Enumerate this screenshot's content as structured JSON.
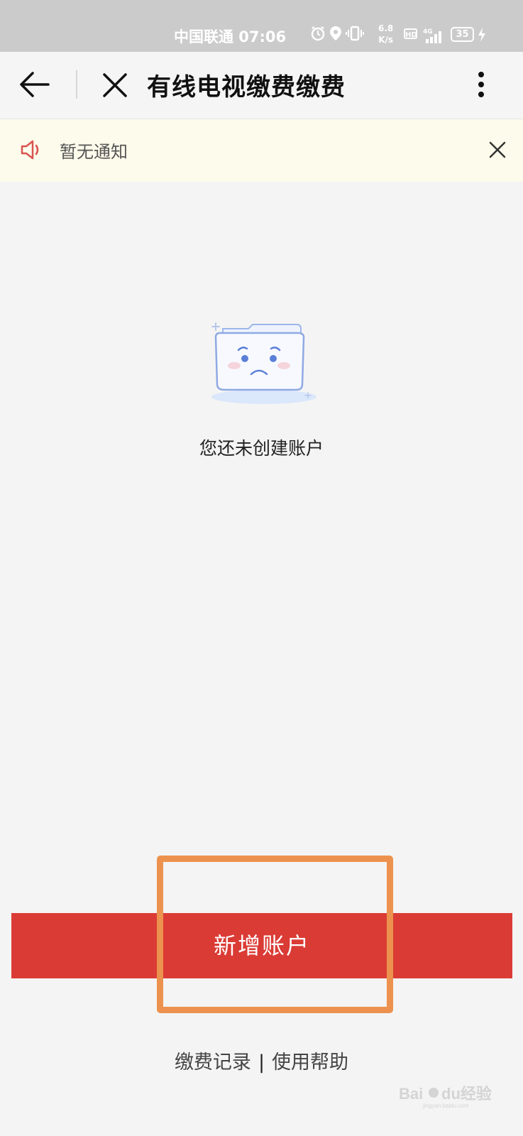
{
  "status_bar": {
    "carrier_time": "中国联通 07:06",
    "speed_value": "6.8",
    "speed_unit": "K/s",
    "hd_label": "HD",
    "network_label": "4G",
    "battery": "35",
    "icons": [
      "alarm-icon",
      "location-icon",
      "vibrate-icon",
      "signal-icon",
      "charging-icon"
    ]
  },
  "nav": {
    "title": "有线电视缴费缴费",
    "icons": [
      "back-arrow-icon",
      "close-icon",
      "more-vertical-icon"
    ]
  },
  "notice": {
    "text": "暂无通知",
    "icons": [
      "speaker-icon",
      "close-icon"
    ],
    "accent_color": "#d9534f"
  },
  "empty_state": {
    "message": "您还未创建账户",
    "icon": "sad-folder-icon"
  },
  "actions": {
    "add_account_label": "新增账户",
    "button_color": "#db3b35",
    "highlight_color": "#ec924e"
  },
  "footer": {
    "payment_records": "缴费记录",
    "separator": "|",
    "help": "使用帮助"
  },
  "watermark": {
    "text": "Baidu经验",
    "url": "jingyan.baidu.com"
  }
}
